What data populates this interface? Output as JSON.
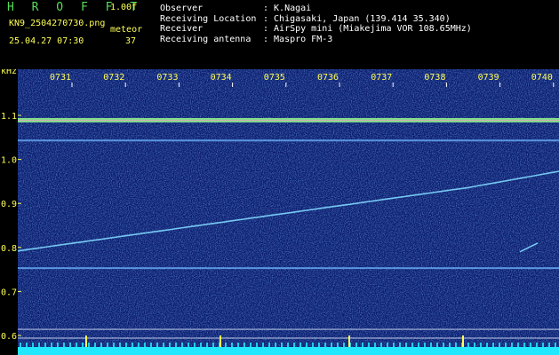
{
  "header": {
    "brand": "H R O F F T",
    "version": "1.00f",
    "filename": "KN9_2504270730.png",
    "mode": "meteor",
    "datetime": "25.04.27 07:30",
    "count": "37"
  },
  "info": [
    {
      "key": "Observer",
      "value": ": K.Nagai"
    },
    {
      "key": "Receiving Location",
      "value": ": Chigasaki, Japan (139.414 35.340)"
    },
    {
      "key": "Receiver",
      "value": ": AirSpy mini (Miakejima VOR 108.65MHz)"
    },
    {
      "key": "Receiving antenna",
      "value": ": Maspro FM-3"
    }
  ],
  "chart_data": {
    "type": "heatmap",
    "ylabel": "kHz",
    "y_ticks": [
      "1.1",
      "1.0",
      "0.9",
      "0.8",
      "0.7",
      "0.6"
    ],
    "x_ticks": [
      "0731",
      "0732",
      "0733",
      "0734",
      "0735",
      "0736",
      "0737",
      "0738",
      "0739",
      "0740"
    ],
    "colors": {
      "background": "#0a1a6e",
      "noise": "#2e6fd0",
      "carrier": "#8cf08c",
      "accent": "#ffff55",
      "baseline": "#22e8ff"
    }
  }
}
